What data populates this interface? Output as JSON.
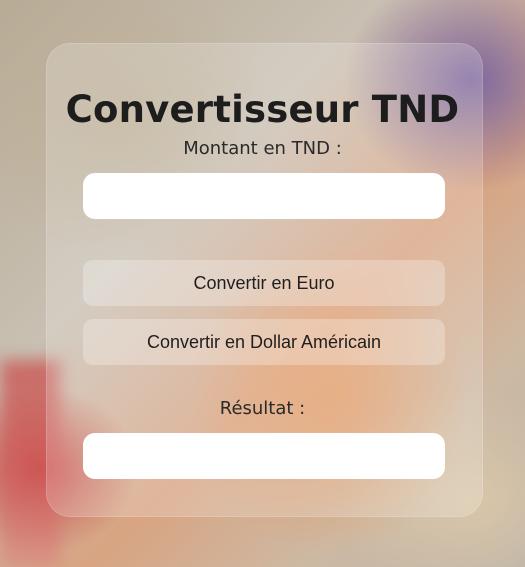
{
  "app": {
    "title": "Convertisseur TND"
  },
  "amount": {
    "label": "Montant en TND :",
    "value": "",
    "placeholder": ""
  },
  "buttons": {
    "euro": "Convertir en Euro",
    "usd": "Convertir en Dollar Américain"
  },
  "result": {
    "label": "Résultat :",
    "value": ""
  },
  "colors": {
    "text": "#1d1d1d",
    "field_background": "#ffffff",
    "card_background": "rgba(255,255,255,0.2)"
  }
}
